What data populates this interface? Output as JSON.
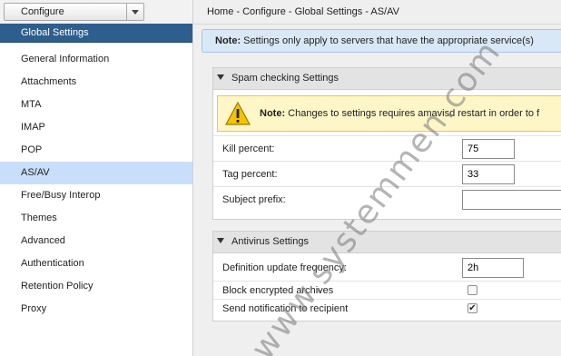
{
  "configure": {
    "label": "Configure"
  },
  "nav": {
    "header": "Global Settings",
    "items": [
      {
        "label": "General Information",
        "active": false
      },
      {
        "label": "Attachments",
        "active": false
      },
      {
        "label": "MTA",
        "active": false
      },
      {
        "label": "IMAP",
        "active": false
      },
      {
        "label": "POP",
        "active": false
      },
      {
        "label": "AS/AV",
        "active": true
      },
      {
        "label": "Free/Busy Interop",
        "active": false
      },
      {
        "label": "Themes",
        "active": false
      },
      {
        "label": "Advanced",
        "active": false
      },
      {
        "label": "Authentication",
        "active": false
      },
      {
        "label": "Retention Policy",
        "active": false
      },
      {
        "label": "Proxy",
        "active": false
      }
    ]
  },
  "breadcrumb": "Home - Configure - Global Settings - AS/AV",
  "note": {
    "prefix": "Note:",
    "text": " Settings only apply to servers that have the appropriate service(s)"
  },
  "spam": {
    "title": "Spam checking Settings",
    "warning_prefix": "Note:",
    "warning_text": " Changes to settings requires amavisd restart in order to f",
    "kill_label": "Kill percent:",
    "kill_value": "75",
    "tag_label": "Tag percent:",
    "tag_value": "33",
    "subject_label": "Subject prefix:",
    "subject_value": ""
  },
  "antivirus": {
    "title": "Antivirus Settings",
    "def_label": "Definition update frequency:",
    "def_value": "2h",
    "block_label": "Block encrypted archives",
    "block_checked": false,
    "notify_label": "Send notification to recipient",
    "notify_checked": true
  },
  "watermark": "www.systemmen.com",
  "colors": {
    "nav_header": "#2d5e8e",
    "active_item": "#c9defa",
    "note_bg": "#d9e8f7",
    "warning_bg": "#fff6c8"
  }
}
